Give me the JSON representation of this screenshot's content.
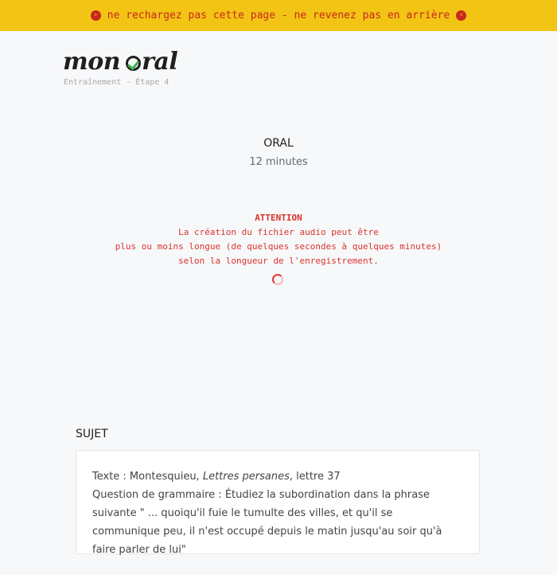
{
  "banner": {
    "text": "ne rechargez pas cette page - ne revenez pas en arrière",
    "left_icon": "chevron-circle-right-icon",
    "right_icon": "chevron-circle-left-icon",
    "colors": {
      "background": "#f2c414",
      "text": "#c8281e"
    }
  },
  "logo": {
    "part1": "mon",
    "part2": "ral"
  },
  "step_label": "Entraînement - Étape 4",
  "oral": {
    "title": "ORAL",
    "duration": "12 minutes"
  },
  "attention": {
    "heading": "ATTENTION",
    "line1": "La création du fichier audio peut être",
    "line2": "plus ou moins longue (de quelques secondes à quelques minutes)",
    "line3": "selon la longueur de l'enregistrement."
  },
  "sujet": {
    "label": "SUJET",
    "text_prefix": "Texte : Montesquieu, ",
    "text_title": "Lettres persanes",
    "text_suffix": ", lettre 37",
    "question": "Question de grammaire : Étudiez la subordination dans la phrase suivante \" ... quoiqu'il fuie le tumulte des villes, et qu'il se communique peu, il n'est occupé depuis le matin jusqu'au soir qu'à faire parler de lui\""
  }
}
